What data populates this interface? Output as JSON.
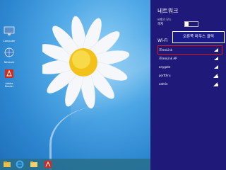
{
  "desktop": {
    "icons": [
      {
        "name": "computer-icon",
        "label": "Computer"
      },
      {
        "name": "network-icon",
        "label": "Network"
      },
      {
        "name": "pdf-icon",
        "label": "Adobe Reader"
      }
    ]
  },
  "taskbar": {
    "buttons": [
      "file-explorer",
      "internet-explorer",
      "folder",
      "pdf"
    ]
  },
  "network_panel": {
    "title": "네트워크",
    "airplane_label": "비행기 모드",
    "airplane_value": "해제",
    "wifi_header": "Wi-Fi",
    "tooltip": "오른쪽 마우스 클릭",
    "networks": [
      {
        "ssid": "iTimeLink",
        "selected": true
      },
      {
        "ssid": "iTimeLink AP",
        "selected": false
      },
      {
        "ssid": "anygate",
        "selected": false
      },
      {
        "ssid": "portthru",
        "selected": false
      },
      {
        "ssid": "admin",
        "selected": false
      }
    ]
  },
  "colors": {
    "panel_bg": "#1f1a7a",
    "highlight": "#e01818"
  }
}
